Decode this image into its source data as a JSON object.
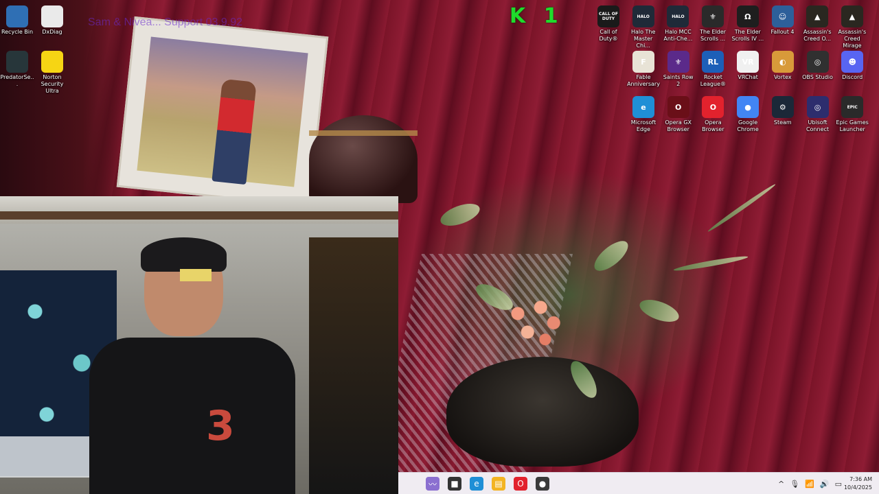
{
  "watermark": {
    "corner_text": "K 1",
    "faded_text": "Sam & Nivea... Support 03.9.92"
  },
  "desktop": {
    "left_icons": [
      {
        "label": "Recycle Bin",
        "icon": "recycle-bin-icon",
        "color": "#2f6fb4"
      },
      {
        "label": "DxDiag",
        "icon": "document-icon",
        "color": "#eaeaea"
      },
      {
        "label": "PredatorSe...",
        "icon": "predator-sense-icon",
        "color": "#27363a"
      },
      {
        "label": "Norton Security Ultra",
        "icon": "norton-icon",
        "color": "#f6d514"
      }
    ],
    "right_icons": [
      {
        "label": "Call of Duty®",
        "icon": "call-of-duty-icon",
        "color": "#1a1a1a",
        "glyph": "CALL OF DUTY"
      },
      {
        "label": "Halo The Master Chi...",
        "icon": "halo-mcc-icon",
        "color": "#1f2a38",
        "glyph": "HALO"
      },
      {
        "label": "Halo MCC Anti-Che...",
        "icon": "halo-anticheat-icon",
        "color": "#1f2a38",
        "glyph": "HALO"
      },
      {
        "label": "The Elder Scrolls ...",
        "icon": "elder-scrolls-skyrim-icon",
        "color": "#2a2a2a",
        "glyph": "⚜"
      },
      {
        "label": "The Elder Scrolls IV ...",
        "icon": "elder-scrolls-oblivion-icon",
        "color": "#1e1e1e",
        "glyph": "Ω"
      },
      {
        "label": "Fallout 4",
        "icon": "fallout-4-icon",
        "color": "#2d5f9a",
        "glyph": "☺"
      },
      {
        "label": "Assassin's Creed O...",
        "icon": "assassins-creed-origins-icon",
        "color": "#2a2720",
        "glyph": "▲"
      },
      {
        "label": "Assassin's Creed Mirage",
        "icon": "assassins-creed-mirage-icon",
        "color": "#2a2720",
        "glyph": "▲"
      },
      {
        "label": "Fable Anniversary",
        "icon": "fable-icon",
        "color": "#e8e3d6",
        "glyph": "F"
      },
      {
        "label": "Saints Row 2",
        "icon": "saints-row-icon",
        "color": "#5b2a8a",
        "glyph": "⚜"
      },
      {
        "label": "Rocket League®",
        "icon": "rocket-league-icon",
        "color": "#1d5fb8",
        "glyph": "RL"
      },
      {
        "label": "VRChat",
        "icon": "vrchat-icon",
        "color": "#f0f0f0",
        "glyph": "VR"
      },
      {
        "label": "Vortex",
        "icon": "vortex-icon",
        "color": "#d89a3a",
        "glyph": "◐"
      },
      {
        "label": "OBS Studio",
        "icon": "obs-studio-icon",
        "color": "#303030",
        "glyph": "◎"
      },
      {
        "label": "Discord",
        "icon": "discord-icon",
        "color": "#5865f2",
        "glyph": "☻"
      },
      {
        "label": "Microsoft Edge",
        "icon": "edge-icon",
        "color": "#1f8fd6",
        "glyph": "e"
      },
      {
        "label": "Opera GX Browser",
        "icon": "opera-gx-icon",
        "color": "#6a0f18",
        "glyph": "O"
      },
      {
        "label": "Opera Browser",
        "icon": "opera-icon",
        "color": "#e2222d",
        "glyph": "O"
      },
      {
        "label": "Google Chrome",
        "icon": "chrome-icon",
        "color": "#4285f4",
        "glyph": "●"
      },
      {
        "label": "Steam",
        "icon": "steam-icon",
        "color": "#1b2838",
        "glyph": "⚙"
      },
      {
        "label": "Ubisoft Connect",
        "icon": "ubisoft-connect-icon",
        "color": "#2d2d6d",
        "glyph": "◎"
      },
      {
        "label": "Epic Games Launcher",
        "icon": "epic-games-icon",
        "color": "#2a2a2a",
        "glyph": "EPIC"
      }
    ]
  },
  "taskbar": {
    "pinned": [
      {
        "name": "app-swirl-icon",
        "glyph": "〰",
        "color": "#8b6fd0"
      },
      {
        "name": "terminal-icon",
        "glyph": "■",
        "color": "#333333"
      },
      {
        "name": "edge-taskbar-icon",
        "glyph": "e",
        "color": "#1f8fd6"
      },
      {
        "name": "file-explorer-icon",
        "glyph": "▤",
        "color": "#f3b422"
      },
      {
        "name": "opera-taskbar-icon",
        "glyph": "O",
        "color": "#e2222d"
      },
      {
        "name": "recorder-taskbar-icon",
        "glyph": "●",
        "color": "#3a3a3a"
      }
    ],
    "tray": {
      "chevron": "^",
      "mic": "🎙",
      "wifi": "📶",
      "volume": "🔊",
      "battery": "▭"
    },
    "time": "7:36 AM",
    "date": "10/4/2025"
  }
}
